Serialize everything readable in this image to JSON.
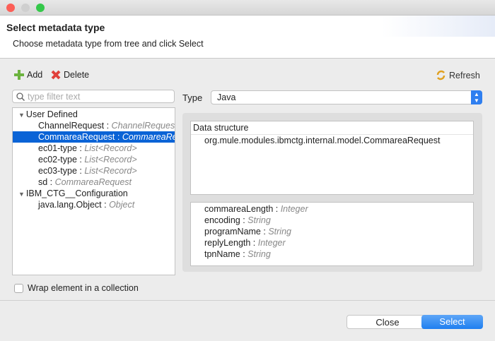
{
  "dialog": {
    "title": "Select metadata type",
    "subtitle": "Choose metadata type from tree and click Select"
  },
  "toolbar": {
    "add": "Add",
    "delete": "Delete",
    "refresh": "Refresh"
  },
  "filter": {
    "placeholder": "type filter text"
  },
  "tree": [
    {
      "name": "User Defined",
      "type": "",
      "level": 0,
      "group": true
    },
    {
      "name": "ChannelRequest",
      "type": "ChannelRequest",
      "level": 1
    },
    {
      "name": "CommareaRequest",
      "type": "CommareaRequest",
      "level": 1,
      "selected": true
    },
    {
      "name": "ec01-type",
      "type": "List<Record>",
      "level": 1
    },
    {
      "name": "ec02-type",
      "type": "List<Record>",
      "level": 1
    },
    {
      "name": "ec03-type",
      "type": "List<Record>",
      "level": 1
    },
    {
      "name": "sd",
      "type": "CommareaRequest",
      "level": 1
    },
    {
      "name": "IBM_CTG__Configuration",
      "type": "",
      "level": 0,
      "group": true
    },
    {
      "name": "java.lang.Object",
      "type": "Object",
      "level": 1
    }
  ],
  "type_field": {
    "label": "Type",
    "value": "Java"
  },
  "structure": {
    "header": "Data structure",
    "class": "org.mule.modules.ibmctg.internal.model.CommareaRequest"
  },
  "fields": [
    {
      "name": "commareaLength",
      "type": "Integer"
    },
    {
      "name": "encoding",
      "type": "String"
    },
    {
      "name": "programName",
      "type": "String"
    },
    {
      "name": "replyLength",
      "type": "Integer"
    },
    {
      "name": "tpnName",
      "type": "String"
    }
  ],
  "wrap": {
    "label": "Wrap element in a collection",
    "checked": false
  },
  "buttons": {
    "close": "Close",
    "select": "Select"
  },
  "colors": {
    "accent": "#0a63d6"
  }
}
